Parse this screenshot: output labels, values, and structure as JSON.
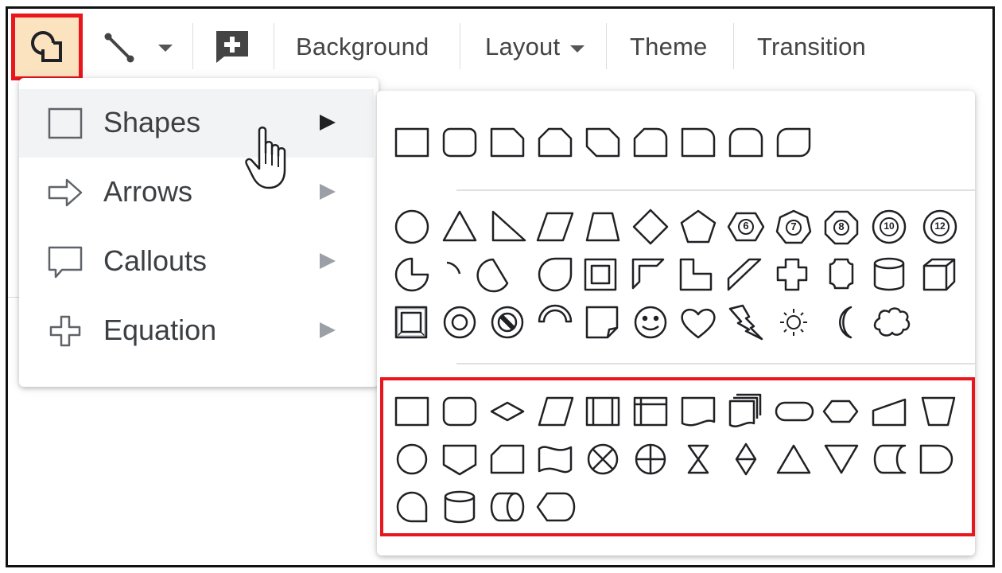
{
  "toolbar": {
    "shape_tool_icon": "shape-tool-icon",
    "line_tool_icon": "line-tool-icon",
    "line_dropdown_icon": "caret-down-icon",
    "comment_icon": "add-comment-icon",
    "background_label": "Background",
    "layout_label": "Layout",
    "theme_label": "Theme",
    "transition_label": "Transition",
    "highlight_color": "#e8161d",
    "active_button_color": "#fbe3c0"
  },
  "menu": {
    "items": [
      {
        "label": "Shapes",
        "icon": "rectangle-icon",
        "has_submenu": true,
        "hovered": true
      },
      {
        "label": "Arrows",
        "icon": "arrow-right-icon",
        "has_submenu": true
      },
      {
        "label": "Callouts",
        "icon": "callout-icon",
        "has_submenu": true
      },
      {
        "label": "Equation",
        "icon": "plus-outline-icon",
        "has_submenu": true
      }
    ]
  },
  "submenu": {
    "sections": [
      {
        "name": "rectangles",
        "shapes": [
          "rectangle",
          "rounded-rectangle",
          "snip-single-corner",
          "snip-same-side",
          "snip-diagonal",
          "snip-round-single",
          "round-single-corner",
          "round-same-side",
          "round-diagonal"
        ]
      },
      {
        "name": "basic",
        "shapes": [
          "ellipse",
          "triangle",
          "right-triangle",
          "parallelogram",
          "trapezoid",
          "diamond",
          "pentagon",
          "hexagon-6",
          "heptagon-7",
          "octagon-8",
          "decagon-10",
          "dodecagon-12",
          "pie",
          "arc",
          "chord",
          "teardrop",
          "frame",
          "half-frame",
          "l-shape",
          "diagonal-stripe",
          "cross",
          "plaque",
          "can",
          "cube",
          "bevel",
          "donut",
          "no-symbol",
          "block-arc",
          "folded-corner",
          "smiley",
          "heart",
          "lightning-bolt",
          "sun",
          "moon",
          "cloud"
        ]
      },
      {
        "name": "flowchart",
        "shapes": [
          "process",
          "alternate-process",
          "decision",
          "data",
          "predefined-process",
          "internal-storage",
          "document",
          "multidocument",
          "terminator",
          "preparation",
          "manual-input",
          "manual-operation",
          "connector",
          "off-page-connector",
          "card",
          "punched-tape",
          "summing-junction",
          "or",
          "collate",
          "sort",
          "extract",
          "merge",
          "stored-data",
          "delay",
          "sequential-access",
          "magnetic-disk",
          "direct-access",
          "display"
        ]
      }
    ],
    "polygon_labels": [
      "6",
      "7",
      "8",
      "10",
      "12"
    ]
  }
}
